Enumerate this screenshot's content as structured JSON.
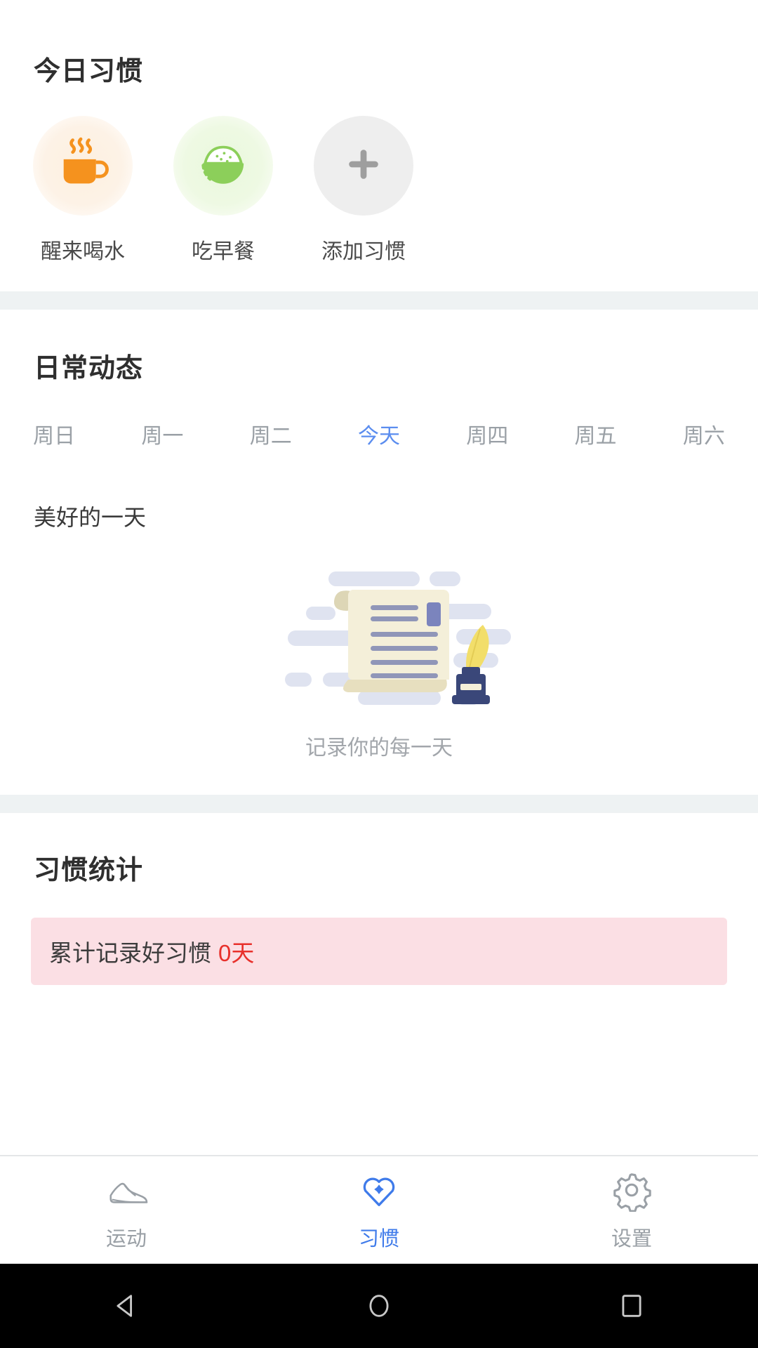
{
  "today_habits": {
    "title": "今日习惯",
    "items": [
      {
        "label": "醒来喝水",
        "icon": "coffee-cup-icon",
        "color": "#f5921e",
        "bubble": "#fdf2e6"
      },
      {
        "label": "吃早餐",
        "icon": "rice-bowl-icon",
        "color": "#8ccf5a",
        "bubble": "#eef9e3"
      },
      {
        "label": "添加习惯",
        "icon": "plus-icon",
        "color": "#9e9e9e",
        "bubble": "#eeeeee"
      }
    ]
  },
  "daily": {
    "title": "日常动态",
    "weekdays": [
      {
        "label": "周日",
        "active": false
      },
      {
        "label": "周一",
        "active": false
      },
      {
        "label": "周二",
        "active": false
      },
      {
        "label": "今天",
        "active": true
      },
      {
        "label": "周四",
        "active": false
      },
      {
        "label": "周五",
        "active": false
      },
      {
        "label": "周六",
        "active": false
      }
    ],
    "day_title": "美好的一天",
    "empty_caption": "记录你的每一天",
    "illustration": "scroll-quill-inkwell-illustration"
  },
  "stats": {
    "title": "习惯统计",
    "row_label": "累计记录好习惯",
    "row_value": "0天",
    "value_color": "#e8302b",
    "background_color": "#fbdfe4"
  },
  "tabbar": {
    "items": [
      {
        "label": "运动",
        "icon": "running-shoe-icon",
        "active": false
      },
      {
        "label": "习惯",
        "icon": "heart-plus-icon",
        "active": true
      },
      {
        "label": "设置",
        "icon": "gear-icon",
        "active": false
      }
    ],
    "active_color": "#3f7bea",
    "inactive_color": "#9aa0a6"
  },
  "system_nav": {
    "back": "back-triangle-icon",
    "home": "home-circle-icon",
    "recents": "recents-square-icon"
  }
}
